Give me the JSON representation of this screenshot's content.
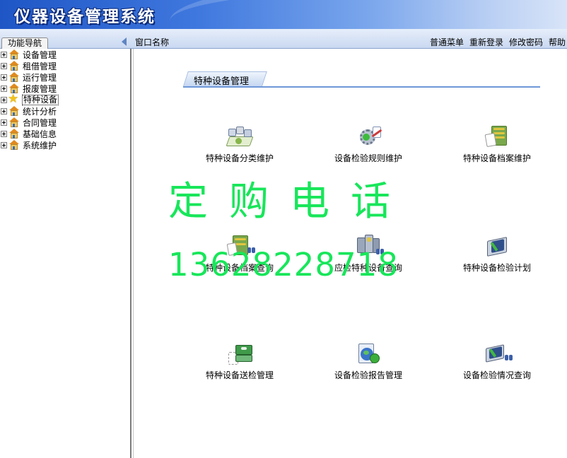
{
  "app": {
    "title": "仪器设备管理系统"
  },
  "toolbar": {
    "nav_tab": "功能导航",
    "window_label": "窗口名称",
    "menu": [
      "普通菜单",
      "重新登录",
      "修改密码",
      "帮助"
    ]
  },
  "sidebar": {
    "items": [
      {
        "label": "设备管理",
        "icon": "house-icon"
      },
      {
        "label": "租借管理",
        "icon": "house-icon"
      },
      {
        "label": "运行管理",
        "icon": "house-icon"
      },
      {
        "label": "报废管理",
        "icon": "house-icon"
      },
      {
        "label": "特种设备",
        "icon": "star-icon",
        "selected": true
      },
      {
        "label": "统计分析",
        "icon": "house-icon"
      },
      {
        "label": "合同管理",
        "icon": "house-icon"
      },
      {
        "label": "基础信息",
        "icon": "house-icon"
      },
      {
        "label": "系统维护",
        "icon": "house-icon"
      }
    ]
  },
  "main": {
    "section_title": "特种设备管理",
    "modules": [
      {
        "label": "特种设备分类维护",
        "icon": "classification-icon"
      },
      {
        "label": "设备检验规则维护",
        "icon": "rules-gear-icon"
      },
      {
        "label": "特种设备档案维护",
        "icon": "archive-icon"
      },
      {
        "label": "特种设备档案查询",
        "icon": "archive-search-icon"
      },
      {
        "label": "应检特种设备查询",
        "icon": "device-search-icon"
      },
      {
        "label": "特种设备检验计划",
        "icon": "inspection-plan-icon"
      },
      {
        "label": "特种设备送检管理",
        "icon": "cash-box-icon"
      },
      {
        "label": "设备检验报告管理",
        "icon": "report-globe-icon"
      },
      {
        "label": "设备检验情况查询",
        "icon": "inspection-search-icon"
      }
    ]
  },
  "watermark": {
    "line1": "定购电话",
    "line2": "13628228718"
  },
  "colors": {
    "header_start": "#1f56c6",
    "watermark": "#18e65a",
    "section_line": "#6e97d8"
  }
}
